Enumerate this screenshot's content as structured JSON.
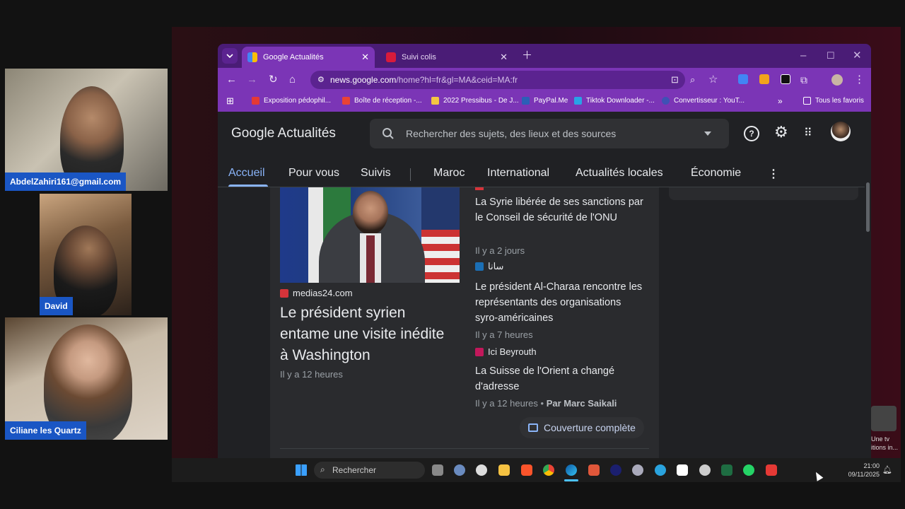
{
  "participants": [
    {
      "name": "AbdelZahiri161@gmail.com"
    },
    {
      "name": "David"
    },
    {
      "name": "Ciliane les Quartz"
    }
  ],
  "browser": {
    "tabs": [
      {
        "label": "Google Actualités",
        "icon": "google-news-icon",
        "active": true
      },
      {
        "label": "Suivi colis",
        "icon": "parcel-icon",
        "active": false
      }
    ],
    "url_host": "news.google.com",
    "url_path": "/home?hl=fr&gl=MA&ceid=MA:fr",
    "bookmarks": [
      "Exposition pédophil...",
      "Boîte de réception -...",
      "2022 Pressibus - De J...",
      "PayPal.Me",
      "Tiktok Downloader -...",
      "Convertisseur : YouT..."
    ],
    "all_bookmarks": "Tous les favoris"
  },
  "news": {
    "logo_google": "Google",
    "logo_product": "Actualités",
    "search_placeholder": "Rechercher des sujets, des lieux et des sources",
    "nav": [
      "Accueil",
      "Pour vous",
      "Suivis",
      "Maroc",
      "International",
      "Actualités locales",
      "Économie"
    ],
    "main_story": {
      "source": "medias24.com",
      "title": "Le président syrien entame une visite inédite à Washington",
      "time": "Il y a 12 heures"
    },
    "related": [
      {
        "title": "La Syrie libérée de ses sanctions par le Conseil de sécurité de l'ONU",
        "time": "Il y a 2 jours"
      },
      {
        "source": "سانا",
        "title": "Le président Al-Charaa rencontre les représentants des organisations syro-américaines",
        "time": "Il y a 7 heures"
      },
      {
        "source": "Ici Beyrouth",
        "title": "La Suisse de l'Orient a changé d'adresse",
        "time": "Il y a 12 heures",
        "author": "Par Marc Saikali"
      }
    ],
    "coverage_button": "Couverture complète"
  },
  "taskbar": {
    "search_label": "Rechercher",
    "time": "21:00",
    "date": "09/11/2025"
  },
  "pip": {
    "caption_line1": "Une tv",
    "caption_line2": "itions in..."
  }
}
